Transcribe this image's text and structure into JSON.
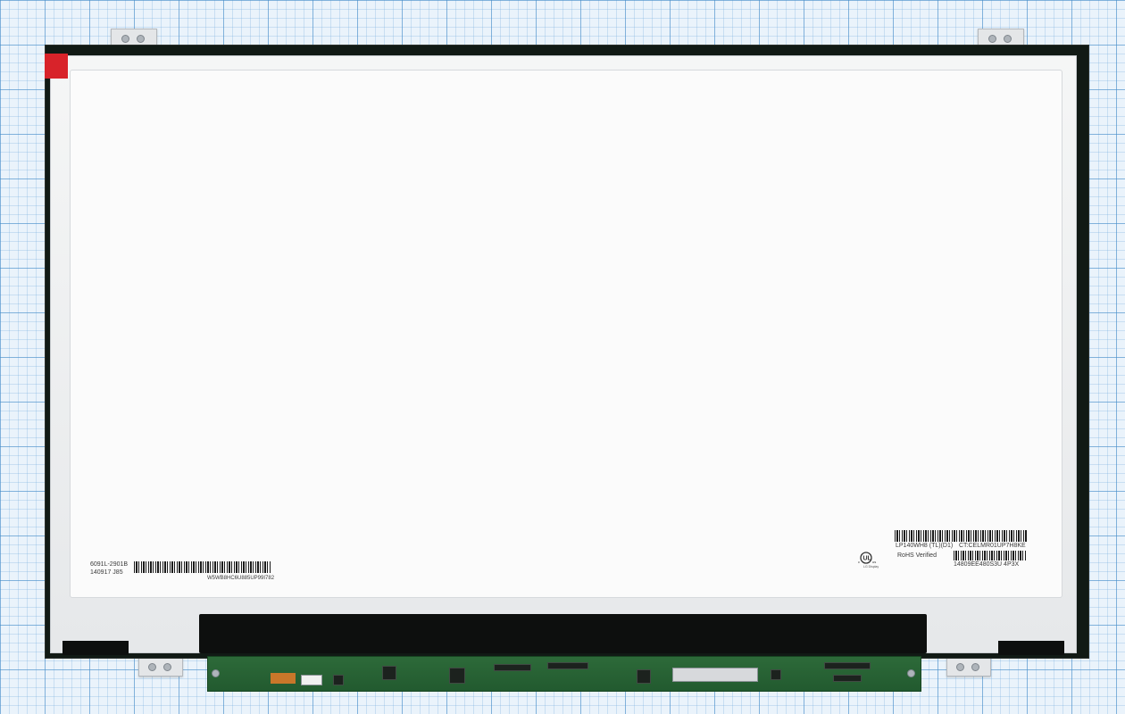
{
  "panel_labels": {
    "left_line1": "6091L-2901B",
    "left_line2": "140917  J85",
    "left_barcode_text": "W5WB8HC6U885UP99I782",
    "model": "LP140WH8  (TL)(D1)",
    "ct_code": "CT:CELMR01UP7H8KE",
    "rohs": "RoHS Verified",
    "serial": "14809EE480S3U  4P3X",
    "ul_mark_text": "c UL us",
    "ul_sub": "LG Display"
  },
  "colors": {
    "frame": "#111a15",
    "tape": "#d8232a",
    "pcb": "#2d6a39",
    "grid": "#468cc8"
  }
}
